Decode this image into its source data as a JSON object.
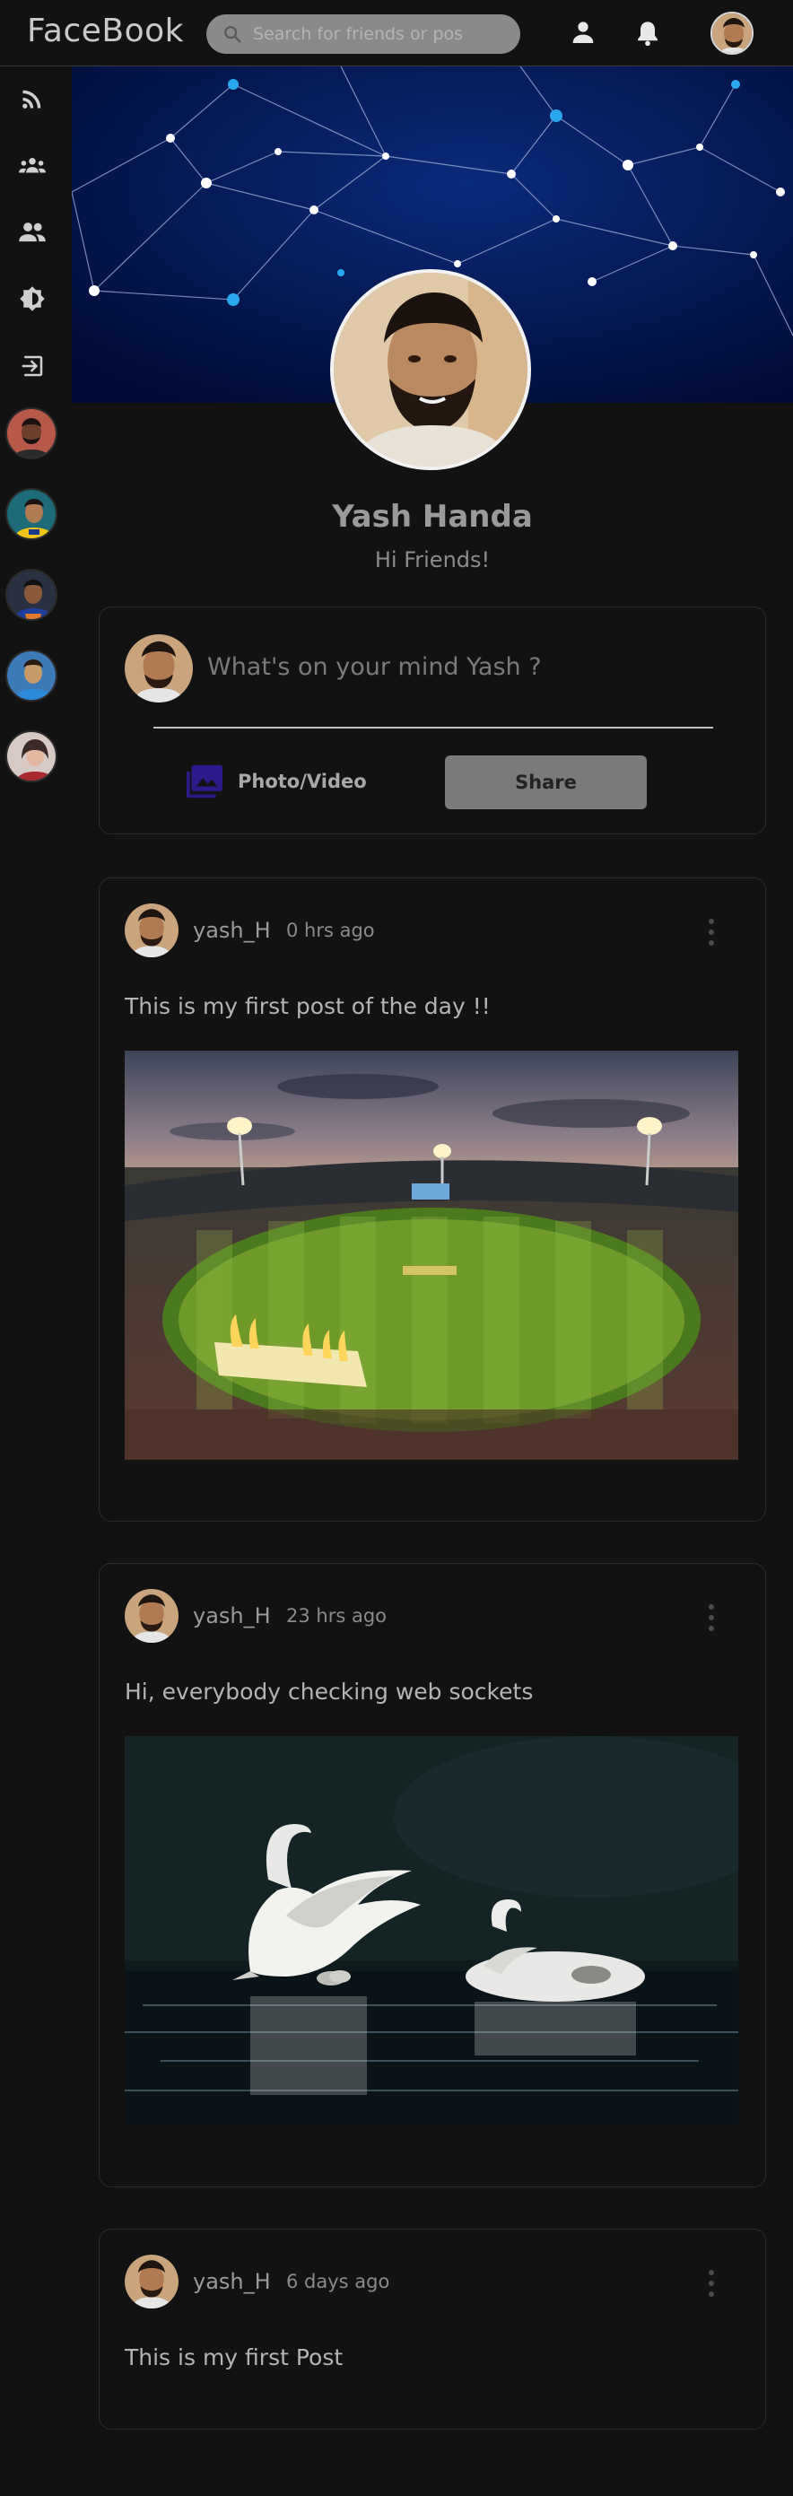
{
  "header": {
    "logo": "FaceBook",
    "search_placeholder": "Search for friends or pos"
  },
  "sidebar": {
    "items": [
      {
        "icon": "rss-feed-icon"
      },
      {
        "icon": "groups-icon"
      },
      {
        "icon": "friends-icon"
      },
      {
        "icon": "theme-toggle-icon"
      },
      {
        "icon": "logout-icon"
      }
    ],
    "friends_count_visible": 5
  },
  "profile": {
    "name": "Yash Handa",
    "status": "Hi Friends!"
  },
  "composer": {
    "placeholder": "What's on your mind Yash ?",
    "photo_label": "Photo/Video",
    "share_label": "Share"
  },
  "posts": [
    {
      "user": "yash_H",
      "time": "0 hrs ago",
      "text": "This is my first post of the day !!",
      "image": "stadium"
    },
    {
      "user": "yash_H",
      "time": "23 hrs ago",
      "text": "Hi, everybody checking web sockets",
      "image": "swans"
    },
    {
      "user": "yash_H",
      "time": "6 days ago",
      "text": "This is my first Post",
      "image": null
    }
  ],
  "colors": {
    "background": "#121212",
    "accent_photo": "#2a1a8a",
    "cover_dark": "#04154d"
  }
}
